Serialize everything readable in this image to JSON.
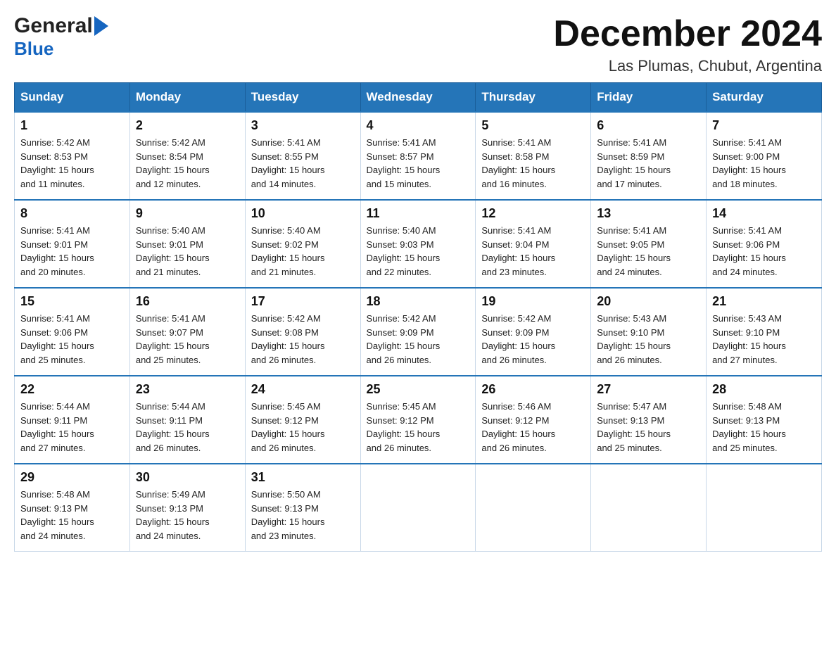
{
  "header": {
    "logo_general": "General",
    "logo_blue": "Blue",
    "month_year": "December 2024",
    "location": "Las Plumas, Chubut, Argentina"
  },
  "weekdays": [
    "Sunday",
    "Monday",
    "Tuesday",
    "Wednesday",
    "Thursday",
    "Friday",
    "Saturday"
  ],
  "weeks": [
    [
      {
        "day": "1",
        "sunrise": "5:42 AM",
        "sunset": "8:53 PM",
        "daylight": "15 hours and 11 minutes."
      },
      {
        "day": "2",
        "sunrise": "5:42 AM",
        "sunset": "8:54 PM",
        "daylight": "15 hours and 12 minutes."
      },
      {
        "day": "3",
        "sunrise": "5:41 AM",
        "sunset": "8:55 PM",
        "daylight": "15 hours and 14 minutes."
      },
      {
        "day": "4",
        "sunrise": "5:41 AM",
        "sunset": "8:57 PM",
        "daylight": "15 hours and 15 minutes."
      },
      {
        "day": "5",
        "sunrise": "5:41 AM",
        "sunset": "8:58 PM",
        "daylight": "15 hours and 16 minutes."
      },
      {
        "day": "6",
        "sunrise": "5:41 AM",
        "sunset": "8:59 PM",
        "daylight": "15 hours and 17 minutes."
      },
      {
        "day": "7",
        "sunrise": "5:41 AM",
        "sunset": "9:00 PM",
        "daylight": "15 hours and 18 minutes."
      }
    ],
    [
      {
        "day": "8",
        "sunrise": "5:41 AM",
        "sunset": "9:01 PM",
        "daylight": "15 hours and 20 minutes."
      },
      {
        "day": "9",
        "sunrise": "5:40 AM",
        "sunset": "9:01 PM",
        "daylight": "15 hours and 21 minutes."
      },
      {
        "day": "10",
        "sunrise": "5:40 AM",
        "sunset": "9:02 PM",
        "daylight": "15 hours and 21 minutes."
      },
      {
        "day": "11",
        "sunrise": "5:40 AM",
        "sunset": "9:03 PM",
        "daylight": "15 hours and 22 minutes."
      },
      {
        "day": "12",
        "sunrise": "5:41 AM",
        "sunset": "9:04 PM",
        "daylight": "15 hours and 23 minutes."
      },
      {
        "day": "13",
        "sunrise": "5:41 AM",
        "sunset": "9:05 PM",
        "daylight": "15 hours and 24 minutes."
      },
      {
        "day": "14",
        "sunrise": "5:41 AM",
        "sunset": "9:06 PM",
        "daylight": "15 hours and 24 minutes."
      }
    ],
    [
      {
        "day": "15",
        "sunrise": "5:41 AM",
        "sunset": "9:06 PM",
        "daylight": "15 hours and 25 minutes."
      },
      {
        "day": "16",
        "sunrise": "5:41 AM",
        "sunset": "9:07 PM",
        "daylight": "15 hours and 25 minutes."
      },
      {
        "day": "17",
        "sunrise": "5:42 AM",
        "sunset": "9:08 PM",
        "daylight": "15 hours and 26 minutes."
      },
      {
        "day": "18",
        "sunrise": "5:42 AM",
        "sunset": "9:09 PM",
        "daylight": "15 hours and 26 minutes."
      },
      {
        "day": "19",
        "sunrise": "5:42 AM",
        "sunset": "9:09 PM",
        "daylight": "15 hours and 26 minutes."
      },
      {
        "day": "20",
        "sunrise": "5:43 AM",
        "sunset": "9:10 PM",
        "daylight": "15 hours and 26 minutes."
      },
      {
        "day": "21",
        "sunrise": "5:43 AM",
        "sunset": "9:10 PM",
        "daylight": "15 hours and 27 minutes."
      }
    ],
    [
      {
        "day": "22",
        "sunrise": "5:44 AM",
        "sunset": "9:11 PM",
        "daylight": "15 hours and 27 minutes."
      },
      {
        "day": "23",
        "sunrise": "5:44 AM",
        "sunset": "9:11 PM",
        "daylight": "15 hours and 26 minutes."
      },
      {
        "day": "24",
        "sunrise": "5:45 AM",
        "sunset": "9:12 PM",
        "daylight": "15 hours and 26 minutes."
      },
      {
        "day": "25",
        "sunrise": "5:45 AM",
        "sunset": "9:12 PM",
        "daylight": "15 hours and 26 minutes."
      },
      {
        "day": "26",
        "sunrise": "5:46 AM",
        "sunset": "9:12 PM",
        "daylight": "15 hours and 26 minutes."
      },
      {
        "day": "27",
        "sunrise": "5:47 AM",
        "sunset": "9:13 PM",
        "daylight": "15 hours and 25 minutes."
      },
      {
        "day": "28",
        "sunrise": "5:48 AM",
        "sunset": "9:13 PM",
        "daylight": "15 hours and 25 minutes."
      }
    ],
    [
      {
        "day": "29",
        "sunrise": "5:48 AM",
        "sunset": "9:13 PM",
        "daylight": "15 hours and 24 minutes."
      },
      {
        "day": "30",
        "sunrise": "5:49 AM",
        "sunset": "9:13 PM",
        "daylight": "15 hours and 24 minutes."
      },
      {
        "day": "31",
        "sunrise": "5:50 AM",
        "sunset": "9:13 PM",
        "daylight": "15 hours and 23 minutes."
      },
      null,
      null,
      null,
      null
    ]
  ]
}
